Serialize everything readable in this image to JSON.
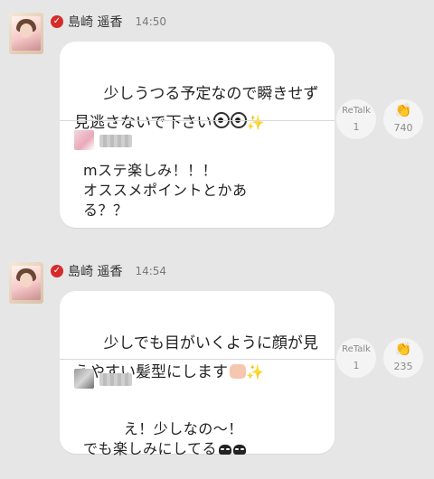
{
  "posts": [
    {
      "author": "島崎 遥香",
      "time": "14:50",
      "message_line1": "少しうつる予定なので瞬きせず",
      "message_line2": "見逃さないで下さい",
      "reply_text": "mステ楽しみ！！！\nオススメポイントとかあ\nる？？",
      "retalk_label": "ReTalk",
      "retalk_count": "1",
      "clap_count": "740"
    },
    {
      "author": "島崎 遥香",
      "time": "14:54",
      "message_line1": "少しでも目がいくように顔が見",
      "message_line2": "えやすい髪型にします",
      "reply_text": "え！少しなの〜！\nでも楽しみにしてる",
      "retalk_label": "ReTalk",
      "retalk_count": "1",
      "clap_count": "235"
    }
  ],
  "icons": {
    "verified": "verified-check-icon",
    "retalk": "retalk-icon",
    "clap": "clap-icon"
  },
  "colors": {
    "background": "#e6e6e6",
    "verified_badge": "#d52b2b",
    "bubble": "#ffffff"
  }
}
